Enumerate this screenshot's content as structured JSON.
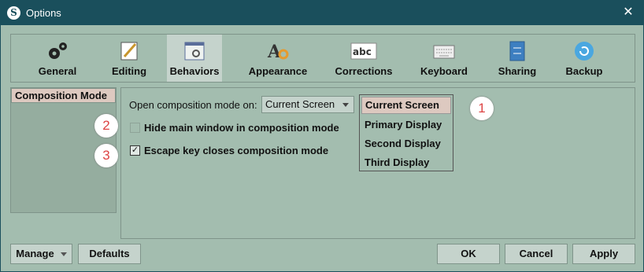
{
  "window": {
    "title": "Options",
    "app_icon_letter": "S",
    "close_glyph": "✕"
  },
  "toolbar": {
    "tabs": [
      {
        "label": "General",
        "icon": "gears-icon"
      },
      {
        "label": "Editing",
        "icon": "pencil-icon"
      },
      {
        "label": "Behaviors",
        "icon": "window-gear-icon",
        "active": true
      },
      {
        "label": "Appearance",
        "icon": "font-color-icon"
      },
      {
        "label": "Corrections",
        "icon": "abc-icon"
      },
      {
        "label": "Keyboard",
        "icon": "keyboard-icon"
      },
      {
        "label": "Sharing",
        "icon": "sharing-icon"
      },
      {
        "label": "Backup",
        "icon": "backup-icon"
      }
    ]
  },
  "sidebar": {
    "items": [
      {
        "label": "Composition Mode",
        "selected": true
      }
    ]
  },
  "panel": {
    "composition_label": "Open composition mode on:",
    "composition_value": "Current Screen",
    "hide_main_window": {
      "label": "Hide main window in composition mode",
      "checked": false
    },
    "escape_closes": {
      "label": "Escape key closes composition mode",
      "checked": true
    },
    "dropdown_options": [
      "Current Screen",
      "Primary Display",
      "Second Display",
      "Third Display"
    ],
    "dropdown_selected": "Current Screen"
  },
  "markers": [
    "1",
    "2",
    "3"
  ],
  "footer": {
    "manage_label": "Manage",
    "defaults_label": "Defaults",
    "ok_label": "OK",
    "cancel_label": "Cancel",
    "apply_label": "Apply"
  },
  "colors": {
    "titlebar": "#1a4f5c",
    "background": "#a3bdaf",
    "active_tab": "#c5d3cc",
    "selected_item": "#ddc9c0",
    "marker_text": "#dd4444"
  }
}
